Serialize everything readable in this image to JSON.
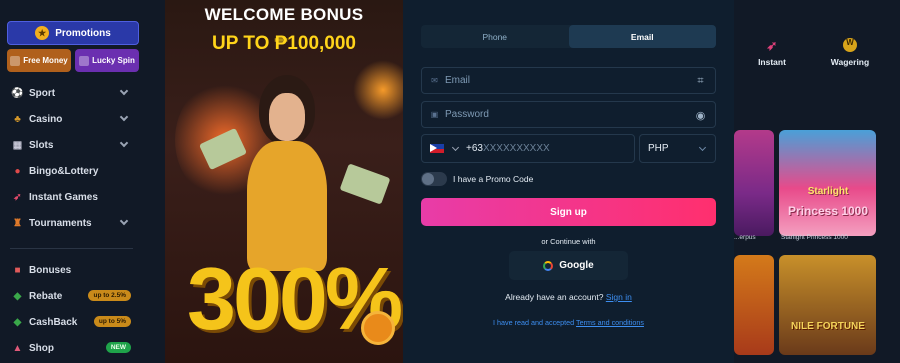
{
  "sidebar": {
    "promotions_label": "Promotions",
    "free_money_label": "Free Money",
    "lucky_spin_label": "Lucky Spin",
    "items": [
      {
        "label": "Sport",
        "icon": "sport-icon",
        "has_chevron": true
      },
      {
        "label": "Casino",
        "icon": "casino-icon",
        "has_chevron": true
      },
      {
        "label": "Slots",
        "icon": "slots-icon",
        "has_chevron": true
      },
      {
        "label": "Bingo&Lottery",
        "icon": "bingo-icon",
        "has_chevron": false
      },
      {
        "label": "Instant Games",
        "icon": "rocket-icon",
        "has_chevron": false
      },
      {
        "label": "Tournaments",
        "icon": "trophy-icon",
        "has_chevron": true
      }
    ],
    "bottom_items": [
      {
        "label": "Bonuses",
        "icon": "gift-icon",
        "badge": ""
      },
      {
        "label": "Rebate",
        "icon": "rebate-icon",
        "badge": "up to 2.5%"
      },
      {
        "label": "CashBack",
        "icon": "cashback-icon",
        "badge": "up to 5%"
      },
      {
        "label": "Shop",
        "icon": "shop-icon",
        "badge": "NEW"
      }
    ]
  },
  "banner": {
    "title": "WELCOME BONUS",
    "subtitle": "UP TO ₱100,000",
    "percent": "300%"
  },
  "modal": {
    "tabs": [
      {
        "label": "Phone",
        "active": false
      },
      {
        "label": "Email",
        "active": true
      }
    ],
    "email_placeholder": "Email",
    "password_placeholder": "Password",
    "phone_code": "+63",
    "phone_placeholder": "XXXXXXXXXX",
    "currency": "PHP",
    "promo_code_label": "I have a Promo Code",
    "signup_label": "Sign up",
    "or_continue": "or Continue with",
    "google_label": "Google",
    "already_text": "Already have an account?",
    "signin_link": "Sign in",
    "terms_prefix": "I have read and accepted",
    "terms_link": "Terms and conditions"
  },
  "right": {
    "nav": [
      {
        "label": "Instant",
        "icon": "rocket-icon"
      },
      {
        "label": "Wagering",
        "icon": "wagering-icon"
      }
    ],
    "games": [
      {
        "label": "...erpus"
      },
      {
        "label": "Starlight Princess 1000",
        "logo_line1": "Starlight",
        "logo_line2": "Princess 1000"
      },
      {
        "label": ""
      },
      {
        "label": "Nile Fortune",
        "logo": "NILE FORTUNE"
      }
    ]
  },
  "colors": {
    "background": "#0c1420",
    "sidebar": "#111926",
    "modal": "#0f1e2e",
    "signup_gradient_start": "#e83ca8",
    "signup_gradient_end": "#ff2f6e",
    "link": "#3d8ef0",
    "banner_accent": "#ffd41a"
  }
}
